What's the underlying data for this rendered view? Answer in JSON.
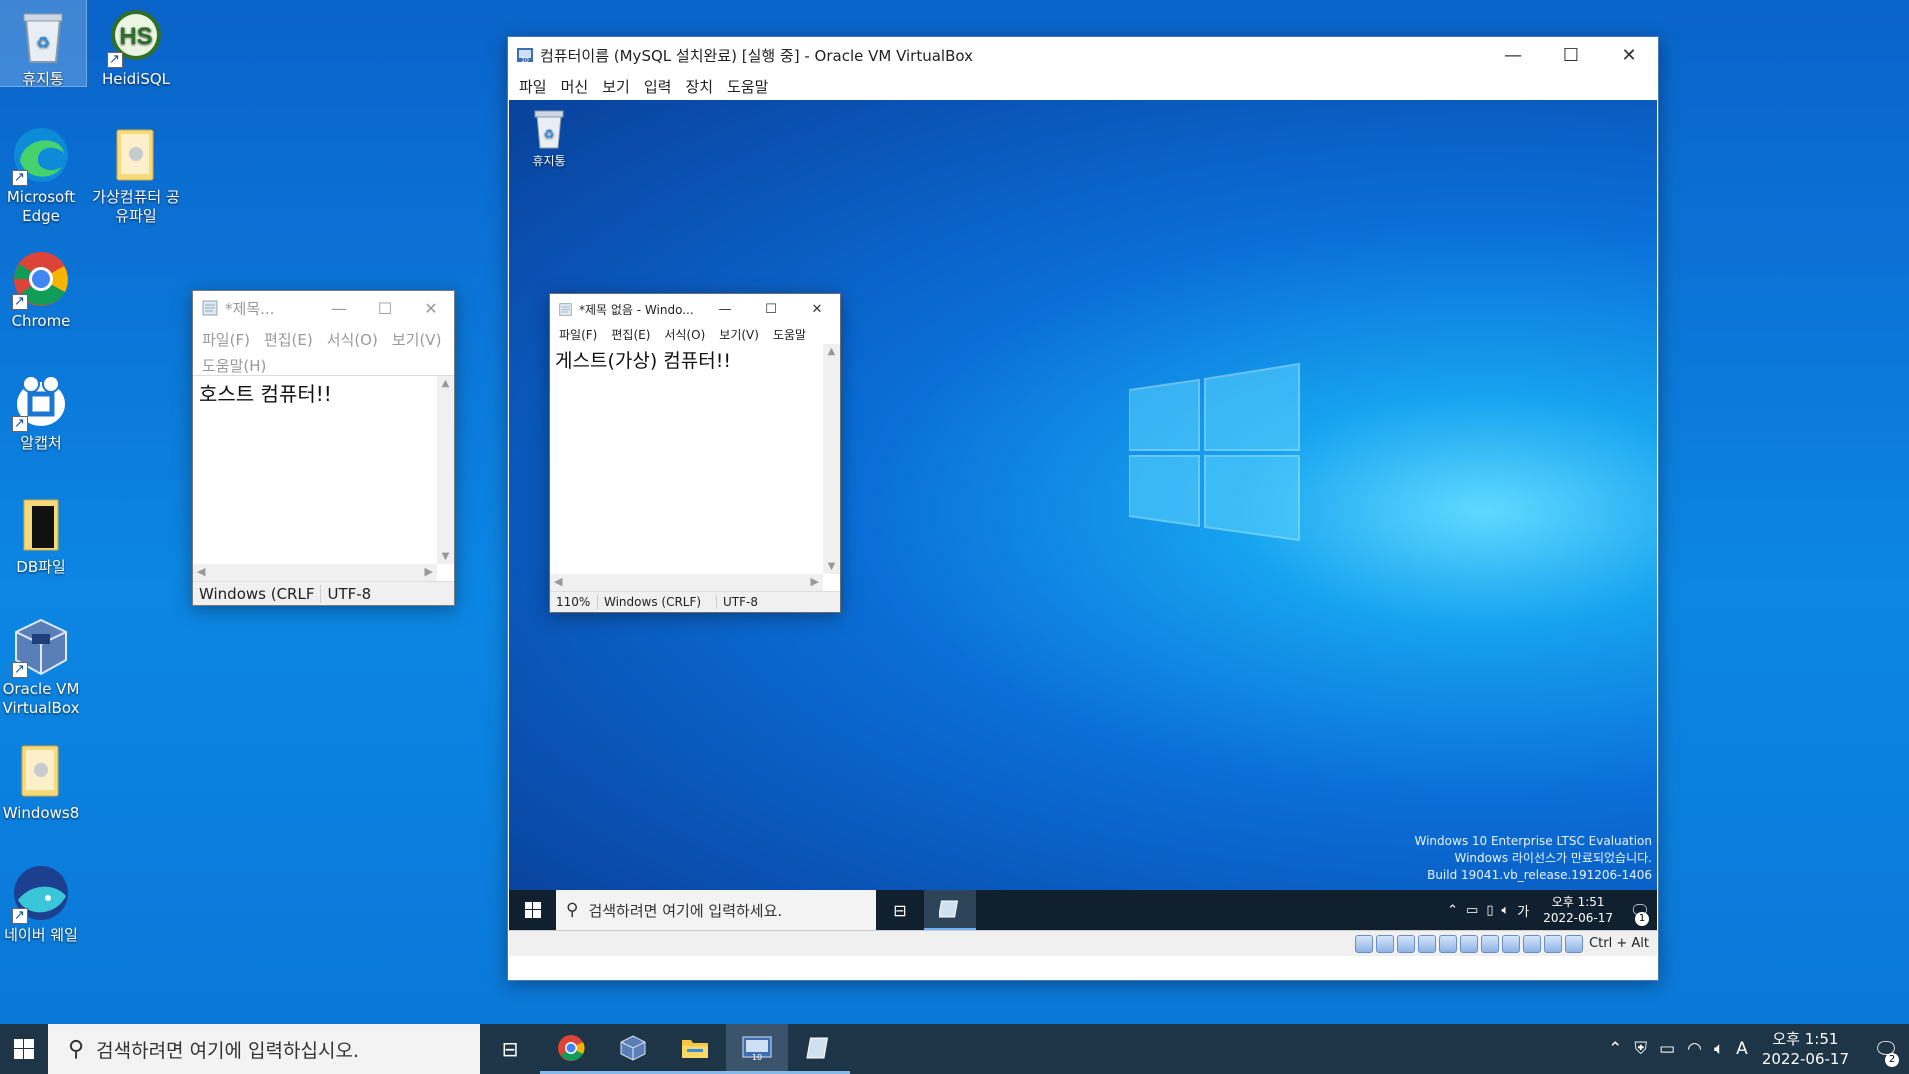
{
  "desktop": {
    "icons": {
      "recycle_bin": "휴지통",
      "heidisql": "HeidiSQL",
      "edge": "Microsoft Edge",
      "shared_folder": "가상컴퓨터 공유파일",
      "chrome": "Chrome",
      "alcapture": "알캡처",
      "db_folder": "DB파일",
      "virtualbox": "Oracle VM VirtualBox",
      "windows8": "Windows8",
      "whale": "네이버 웨일"
    }
  },
  "host_notepad": {
    "title": "*제목...",
    "menu": [
      "파일(F)",
      "편집(E)",
      "서식(O)",
      "보기(V)",
      "도움말(H)"
    ],
    "content": "호스트 컴퓨터!!",
    "status": {
      "eol": "Windows (CRLF",
      "encoding": "UTF-8"
    }
  },
  "vbox": {
    "title": "컴퓨터이름 (MySQL 설치완료) [실행 중] - Oracle VM VirtualBox",
    "menu": [
      "파일",
      "머신",
      "보기",
      "입력",
      "장치",
      "도움말"
    ],
    "host_key": "Ctrl + Alt"
  },
  "guest": {
    "recycle_bin": "휴지통",
    "notepad": {
      "title": "*제목 없음 - Windo...",
      "menu": [
        "파일(F)",
        "편집(E)",
        "서식(O)",
        "보기(V)",
        "도움말"
      ],
      "content": "게스트(가상) 컴퓨터!!",
      "status": {
        "zoom": "110%",
        "eol": "Windows (CRLF)",
        "encoding": "UTF-8"
      }
    },
    "watermark": {
      "line1": "Windows 10 Enterprise LTSC Evaluation",
      "line2": "Windows 라이선스가 만료되었습니다.",
      "line3": "Build 19041.vb_release.191206-1406"
    },
    "taskbar": {
      "search_placeholder": "검색하려면 여기에 입력하세요.",
      "ime": "가",
      "time": "오후 1:51",
      "date": "2022-06-17",
      "notifications": "1"
    }
  },
  "taskbar": {
    "search_placeholder": "검색하려면 여기에 입력하십시오.",
    "ime": "A",
    "time": "오후 1:51",
    "date": "2022-06-17",
    "notifications": "2"
  },
  "colors": {
    "desktop_blue": "#0a76d6",
    "taskbar": "#1e3447",
    "guest_taskbar": "#10202f"
  }
}
